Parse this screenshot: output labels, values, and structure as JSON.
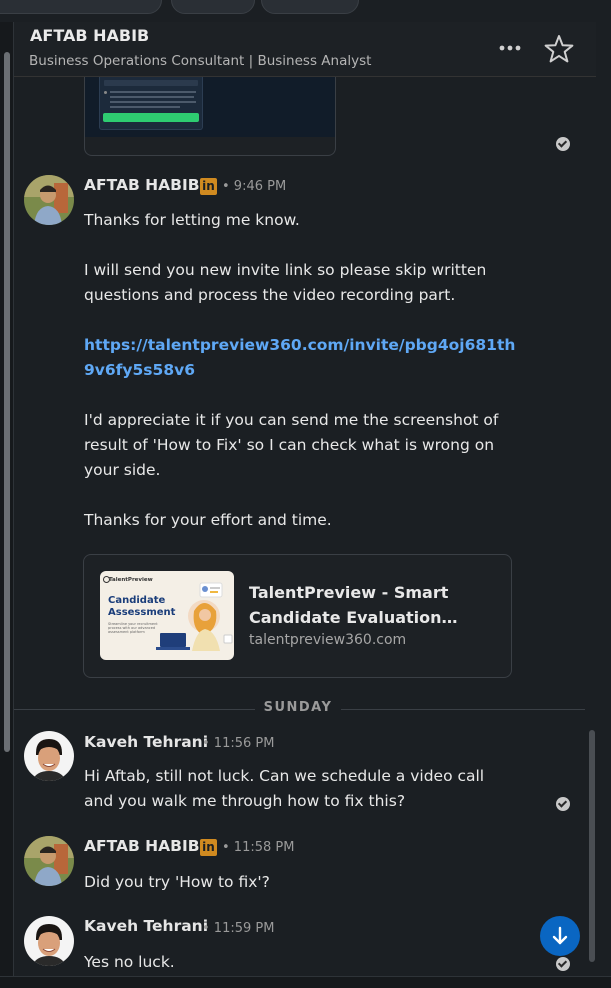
{
  "header": {
    "name": "AFTAB HABIB",
    "headline": "Business Operations Consultant | Business Analyst"
  },
  "messages": {
    "m1": {
      "sender": "AFTAB HABIB",
      "time": "• 9:46 PM",
      "p1": "Thanks for letting me know.",
      "p2": "I will send you new invite link so please skip written questions and process the video recording part.",
      "link": "https://talentpreview360.com/invite/pbg4oj681th9v6fy5s58v6",
      "p3": "I'd appreciate it if you can send me the screenshot of result of 'How to Fix' so I can check what is wrong on your side.",
      "p4": "Thanks for your effort and time.",
      "preview": {
        "title": "TalentPreview - Smart Candidate Evaluation…",
        "domain": "talentpreview360.com",
        "thumb_brand": "TalentPreview",
        "thumb_heading": "Candidate Assessment",
        "thumb_sub": "Streamline your recruitment process with our advanced assessment platform"
      }
    },
    "day_separator": "SUNDAY",
    "m2": {
      "sender": "Kaveh Tehrani",
      "time": "• 11:56 PM",
      "text": "Hi Aftab, still not luck. Can we schedule a video call and you walk me through how to fix this?"
    },
    "m3": {
      "sender": "AFTAB HABIB",
      "time": "• 11:58 PM",
      "text": "Did you try 'How to fix'?"
    },
    "m4": {
      "sender": "Kaveh Tehrani",
      "time": "• 11:59 PM",
      "text": "Yes no luck."
    }
  },
  "icons": {
    "more": "more-horizontal-icon",
    "star": "star-outline-icon",
    "linkedin": "linkedin-badge-icon",
    "read": "read-receipt-icon",
    "scroll": "arrow-down-icon"
  },
  "colors": {
    "background": "#1b1f23",
    "link": "#5fa8f5",
    "accent": "#0a66c2",
    "linkedin_badge": "#d08a20"
  }
}
